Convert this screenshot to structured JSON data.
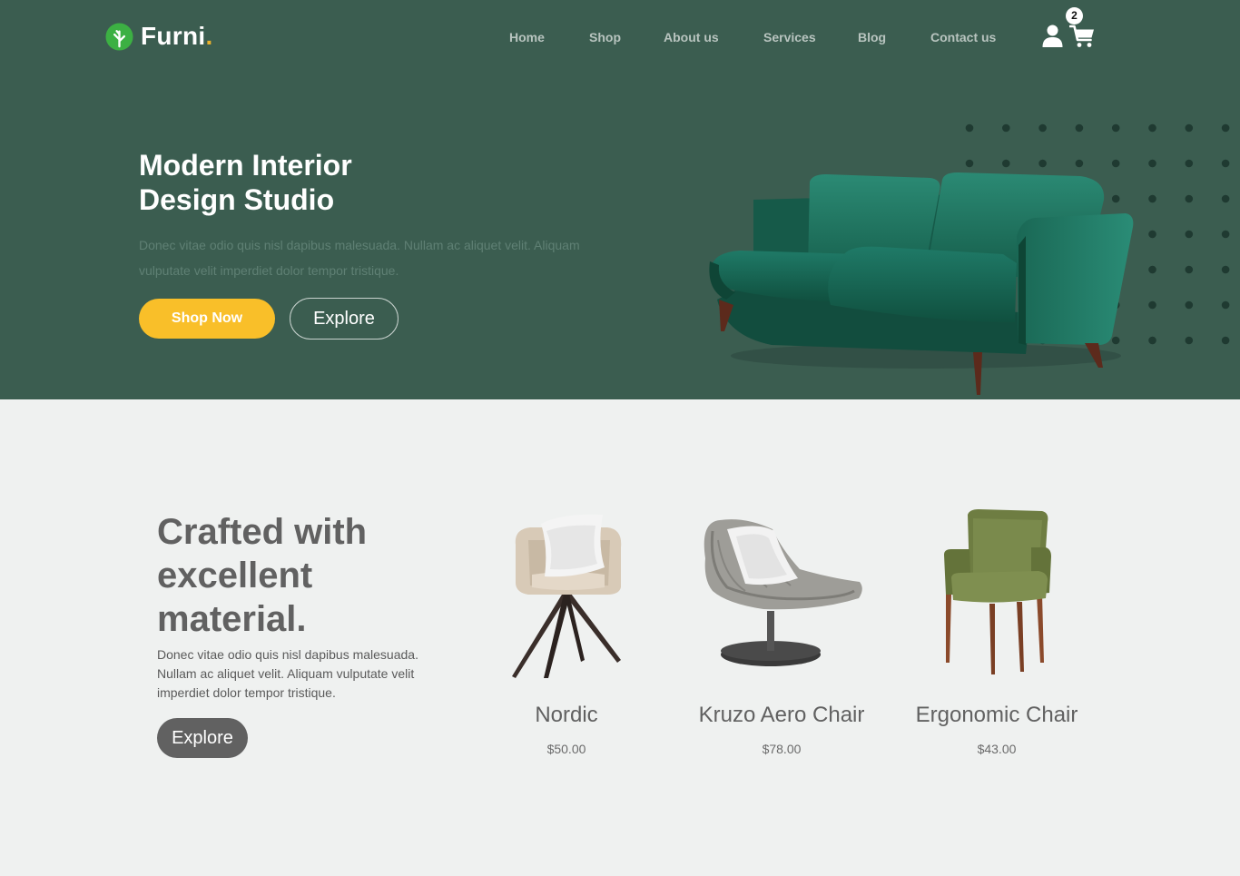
{
  "brand": {
    "name": "Furni",
    "dot": "."
  },
  "nav": {
    "items": [
      {
        "label": "Home"
      },
      {
        "label": "Shop"
      },
      {
        "label": "About us"
      },
      {
        "label": "Services"
      },
      {
        "label": "Blog"
      },
      {
        "label": "Contact us"
      }
    ],
    "cart_count": "2"
  },
  "hero": {
    "title_line1": "Modern Interior",
    "title_line2": "Design Studio",
    "description": "Donec vitae odio quis nisl dapibus malesuada. Nullam ac aliquet velit. Aliquam vulputate velit imperdiet dolor tempor tristique.",
    "primary_button": "Shop Now",
    "secondary_button": "Explore"
  },
  "products_section": {
    "title_line1": "Crafted with",
    "title_line2": "excellent",
    "title_line3": "material.",
    "description": "Donec vitae odio quis nisl dapibus malesuada. Nullam ac aliquet velit. Aliquam vulputate velit imperdiet dolor tempor tristique.",
    "button": "Explore",
    "products": [
      {
        "name": "Nordic",
        "price": "$50.00",
        "icon": "nordic-chair-image"
      },
      {
        "name": "Kruzo Aero Chair",
        "price": "$78.00",
        "icon": "kruzo-aero-chair-image"
      },
      {
        "name": "Ergonomic Chair",
        "price": "$43.00",
        "icon": "ergonomic-chair-image"
      }
    ]
  },
  "colors": {
    "hero_bg": "#3b5d50",
    "accent_yellow": "#f9bf29",
    "page_bg": "#eff1f0",
    "text_gray": "#616161",
    "logo_green": "#3cb043"
  }
}
